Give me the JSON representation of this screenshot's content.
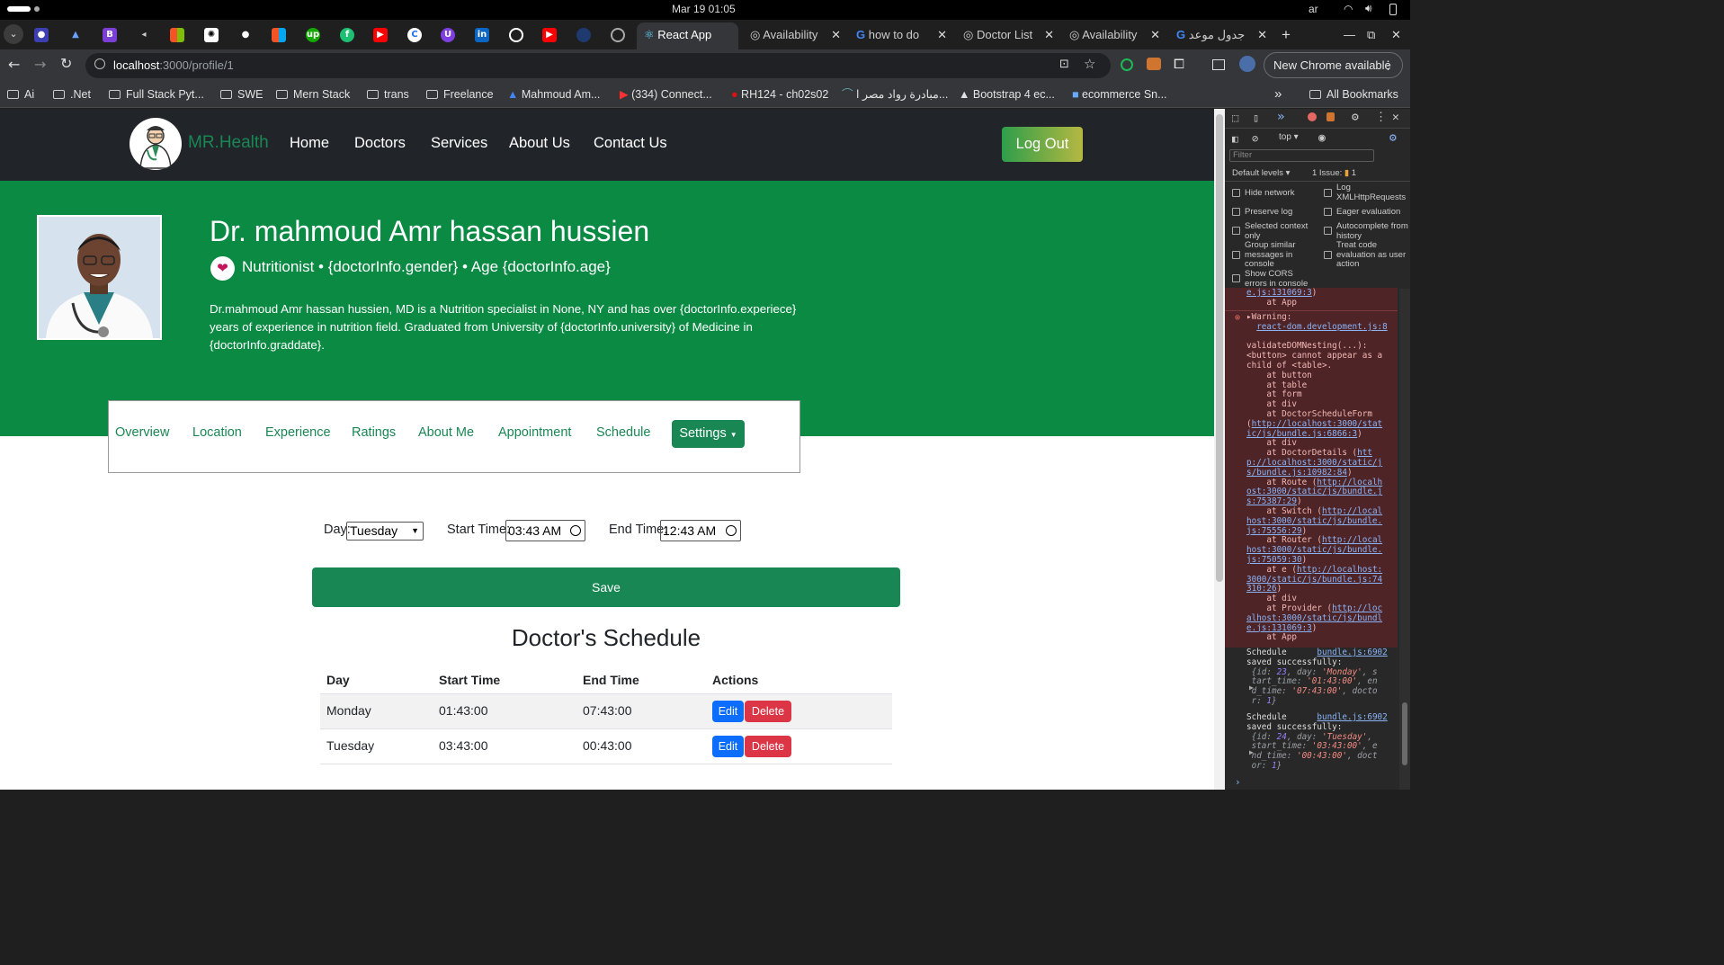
{
  "os": {
    "datetime": "Mar 19  01:05",
    "lang": "ar"
  },
  "tabs": [
    {
      "label": "React App",
      "active": true
    },
    {
      "label": "Availability"
    },
    {
      "label": "how to do"
    },
    {
      "label": "Doctor List"
    },
    {
      "label": "Availability"
    },
    {
      "label": "جدول موعد"
    }
  ],
  "toolbar": {
    "url_host": "localhost",
    "url_rest": ":3000/profile/1",
    "update_label": "New Chrome available"
  },
  "bookmarks": [
    "Ai",
    ".Net",
    "Full Stack Pyt...",
    "SWE",
    "Mern Stack",
    "trans",
    "Freelance",
    "Mahmoud Am...",
    "(334) Connect...",
    "RH124 - ch02s02",
    "مبادرة رواد مصر ا...",
    "Bootstrap 4 ec...",
    "ecommerce Sn...",
    "All Bookmarks"
  ],
  "nav": {
    "brand": "MR.Health",
    "links": [
      "Home",
      "Doctors",
      "Services",
      "About Us",
      "Contact Us"
    ],
    "logout": "Log Out"
  },
  "profile": {
    "name": "Dr. mahmoud Amr hassan hussien",
    "subtitle": "Nutritionist • {doctorInfo.gender} • Age {doctorInfo.age}",
    "bio": [
      "Dr.mahmoud Amr hassan hussien, MD is a Nutrition specialist in None, NY and has over {doctorInfo.experiece}",
      "years of experience in nutrition field. Graduated from University of {doctorInfo.university} of Medicine in",
      "{doctorInfo.graddate}."
    ]
  },
  "profile_tabs": [
    "Overview",
    "Location",
    "Experience",
    "Ratings",
    "About Me",
    "Appointment",
    "Schedule"
  ],
  "settings_label": "Settings",
  "form": {
    "day_label": "Day:",
    "day_value": "Tuesday",
    "start_label": "Start Time:",
    "start_value": "03:43 AM",
    "end_label": "End Time:",
    "end_value": "12:43 AM",
    "save": "Save"
  },
  "schedule": {
    "title": "Doctor's Schedule",
    "headers": [
      "Day",
      "Start Time",
      "End Time",
      "Actions"
    ],
    "rows": [
      {
        "day": "Monday",
        "start": "01:43:00",
        "end": "07:43:00"
      },
      {
        "day": "Tuesday",
        "start": "03:43:00",
        "end": "00:43:00"
      }
    ],
    "edit": "Edit",
    "delete": "Delete"
  },
  "devtools": {
    "context": "top",
    "filter_placeholder": "Filter",
    "levels": "Default levels",
    "issues": "1 Issue:",
    "issue_count": "1",
    "options_left": [
      "Hide network",
      "Preserve log",
      "Selected context only",
      "Group similar messages in console",
      "Show CORS errors in console"
    ],
    "options_right": [
      "Log XMLHttpRequests",
      "Eager evaluation",
      "Autocomplete from history",
      "Treat code evaluation as user action"
    ]
  },
  "colors": {
    "brand_green": "#198754",
    "hero_green": "#0b8a43",
    "navbar": "#212529",
    "logout_gradient_start": "#2e9e4a",
    "logout_gradient_end": "#b5b842"
  }
}
